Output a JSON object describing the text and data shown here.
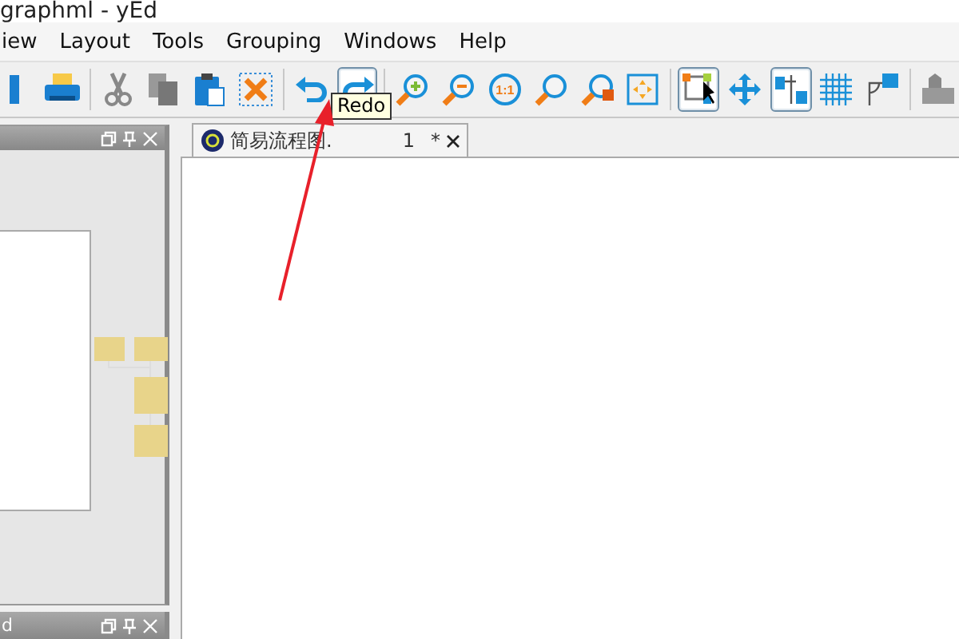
{
  "window": {
    "title": "graphml - yEd"
  },
  "menu": [
    "iew",
    "Layout",
    "Tools",
    "Grouping",
    "Windows",
    "Help"
  ],
  "toolbar": [
    {
      "kind": "save",
      "selected": false
    },
    {
      "kind": "print",
      "selected": false
    },
    {
      "kind": "separator"
    },
    {
      "kind": "cut",
      "selected": false
    },
    {
      "kind": "copy",
      "selected": false
    },
    {
      "kind": "paste",
      "selected": false
    },
    {
      "kind": "delete",
      "selected": false
    },
    {
      "kind": "separator"
    },
    {
      "kind": "undo",
      "selected": false
    },
    {
      "kind": "redo",
      "selected": true
    },
    {
      "kind": "separator"
    },
    {
      "kind": "zoom-in",
      "selected": false
    },
    {
      "kind": "zoom-out",
      "selected": false
    },
    {
      "kind": "zoom-reset",
      "selected": false
    },
    {
      "kind": "zoom",
      "selected": false
    },
    {
      "kind": "zoom-area",
      "selected": false
    },
    {
      "kind": "fit",
      "selected": false
    },
    {
      "kind": "separator"
    },
    {
      "kind": "edit-mode",
      "selected": true
    },
    {
      "kind": "move",
      "selected": false
    },
    {
      "kind": "orthogonal",
      "selected": true
    },
    {
      "kind": "grid",
      "selected": false
    },
    {
      "kind": "snap",
      "selected": false
    },
    {
      "kind": "separator"
    },
    {
      "kind": "export",
      "selected": false
    }
  ],
  "zoom_reset_label": "1:1",
  "tooltip": "Redo",
  "document_tab": {
    "label": "简易流程图.",
    "suffix": "1",
    "modified": "*",
    "selected": true
  },
  "bottom_panel": {
    "title": "d"
  }
}
